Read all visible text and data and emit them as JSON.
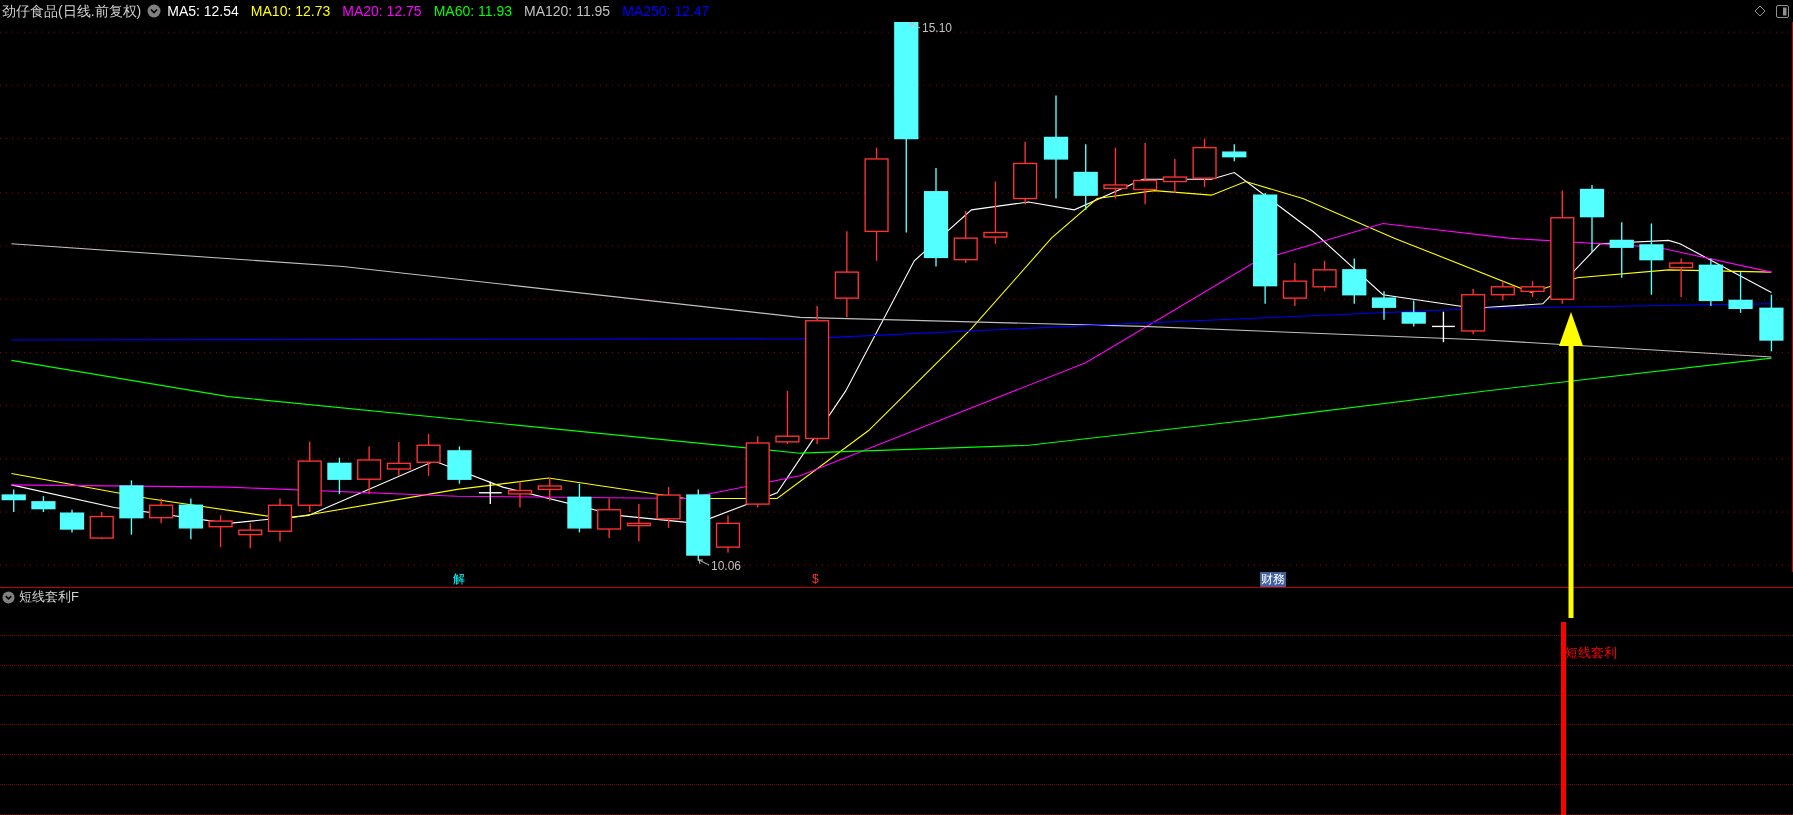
{
  "header": {
    "title": "劲仔食品(日线.前复权)",
    "moving_averages": [
      {
        "label": "MA5:",
        "value": "12.54",
        "color": "#ffffff"
      },
      {
        "label": "MA10:",
        "value": "12.73",
        "color": "#ffff00"
      },
      {
        "label": "MA20:",
        "value": "12.75",
        "color": "#ff00ff"
      },
      {
        "label": "MA60:",
        "value": "11.93",
        "color": "#00ff00"
      },
      {
        "label": "MA120:",
        "value": "11.95",
        "color": "#c0c0c0"
      },
      {
        "label": "MA250:",
        "value": "12.47",
        "color": "#0000ff"
      }
    ]
  },
  "chart": {
    "high_label": "15.10",
    "low_label": "10.06"
  },
  "event_markers": [
    {
      "kind": "unlock",
      "text": "解"
    },
    {
      "kind": "dividend",
      "text": "$"
    },
    {
      "kind": "finance",
      "text": "财務"
    }
  ],
  "indicator_panel": {
    "title": "短线套利F",
    "signal_label": "短线套利"
  }
}
